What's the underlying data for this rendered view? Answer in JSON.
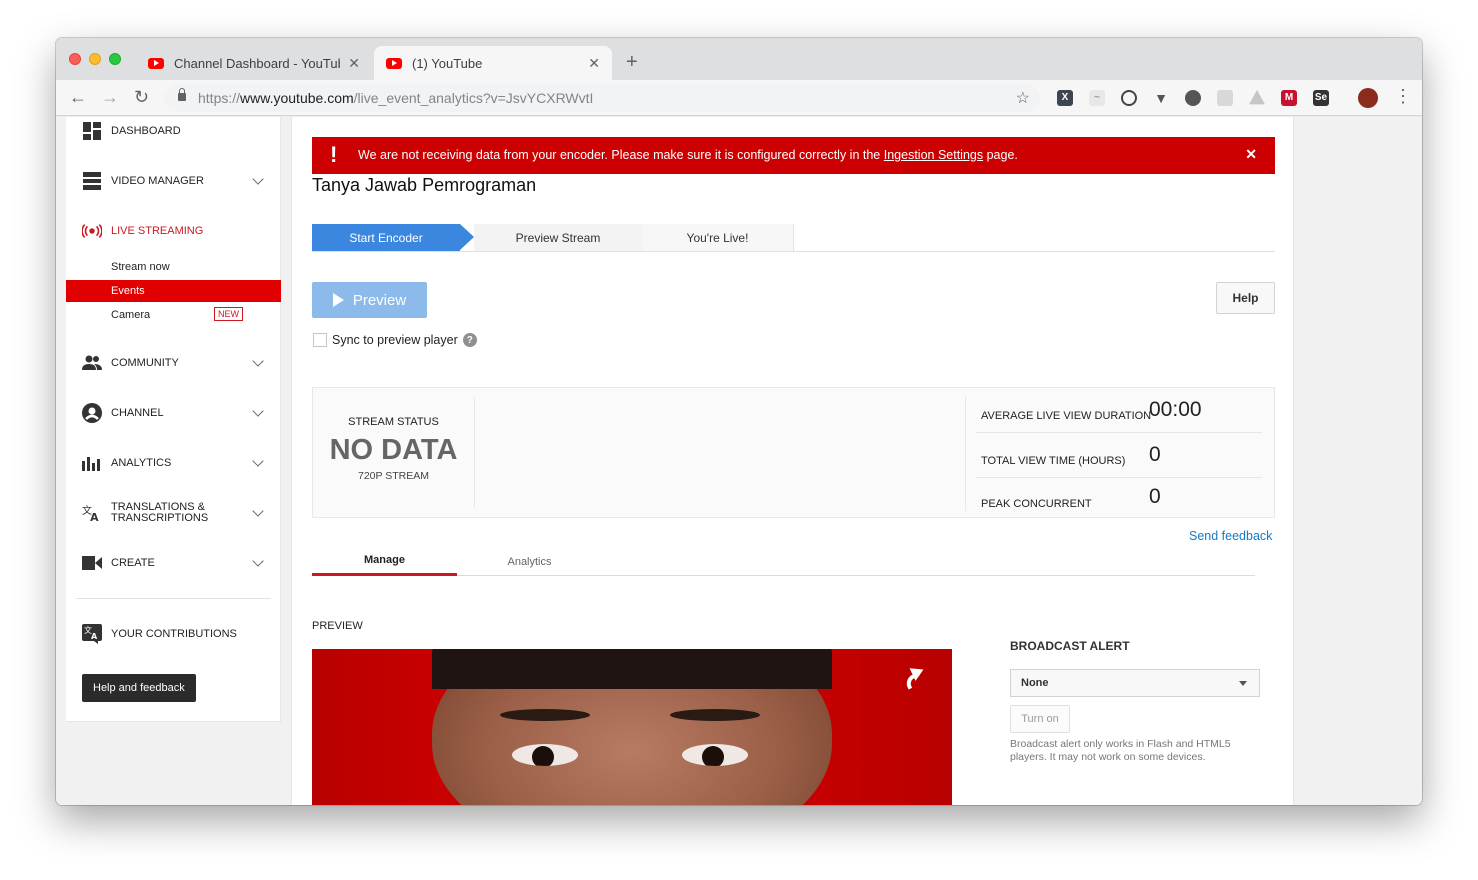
{
  "browser": {
    "tabs": [
      {
        "title": "Channel Dashboard - YouTube",
        "close": "✕"
      },
      {
        "title": "(1) YouTube",
        "close": "✕"
      }
    ],
    "new_tab": "+",
    "back": "←",
    "forward": "→",
    "reload": "↻",
    "url_prefix": "https://",
    "url_host": "www.youtube.com",
    "url_path": "/live_event_analytics?v=JsvYCXRWvtI",
    "star": "☆",
    "menu": "⋮"
  },
  "sidebar": {
    "items": {
      "dashboard": "DASHBOARD",
      "video_manager": "VIDEO MANAGER",
      "live_streaming": "LIVE STREAMING",
      "community": "COMMUNITY",
      "channel": "CHANNEL",
      "analytics": "ANALYTICS",
      "translations": "TRANSLATIONS & TRANSCRIPTIONS",
      "create": "CREATE",
      "contributions": "YOUR CONTRIBUTIONS"
    },
    "live_sub": {
      "stream_now": "Stream now",
      "events": "Events",
      "camera": "Camera",
      "new_badge": "NEW"
    },
    "help_button": "Help and feedback"
  },
  "alert": {
    "icon": "!",
    "message_before": "We are not receiving data from your encoder. Please make sure it is configured correctly in the ",
    "link": "Ingestion Settings",
    "message_after": " page.",
    "close": "✕"
  },
  "event_title": "Tanya Jawab Pemrograman",
  "steps": [
    "Start Encoder",
    "Preview Stream",
    "You're Live!"
  ],
  "preview_button": "Preview",
  "help_button": "Help",
  "sync_label": "Sync to preview player",
  "sync_help": "?",
  "stream_status": {
    "label": "STREAM STATUS",
    "value": "NO DATA",
    "quality": "720P STREAM"
  },
  "metrics": [
    {
      "label": "AVERAGE LIVE VIEW DURATION",
      "value": "00:00"
    },
    {
      "label": "TOTAL VIEW TIME (HOURS)",
      "value": "0"
    },
    {
      "label": "PEAK CONCURRENT",
      "value": "0"
    }
  ],
  "send_feedback": "Send feedback",
  "subtabs": [
    "Manage",
    "Analytics"
  ],
  "preview_section": "PREVIEW",
  "broadcast_alert": {
    "title": "BROADCAST ALERT",
    "selected": "None",
    "turn_on": "Turn on",
    "note": "Broadcast alert only works in Flash and HTML5 players. It may not work on some devices."
  },
  "colors": {
    "alert_red": "#cc0000",
    "selected_red": "#e00000",
    "step_blue": "#3b87e0",
    "link_blue": "#167ac6"
  }
}
